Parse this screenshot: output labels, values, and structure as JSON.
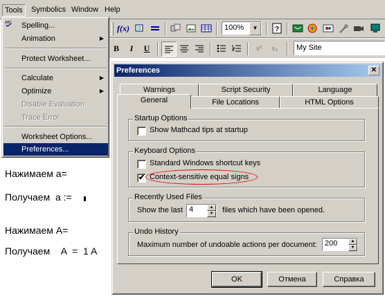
{
  "menubar": {
    "items": [
      "Tools",
      "Symbolics",
      "Window",
      "Help"
    ]
  },
  "toolbar": {
    "zoom_value": "100%",
    "style_value": "My Site",
    "fx_label": "f(x)",
    "bold": "B",
    "italic": "I",
    "underline": "U",
    "superscript": "x²",
    "subscript": "x₂"
  },
  "tools_menu": {
    "items": [
      {
        "label": "Spelling...",
        "disabled": false,
        "submenu": false
      },
      {
        "label": "Animation",
        "disabled": false,
        "submenu": true
      },
      {
        "label": "Protect Worksheet...",
        "disabled": false,
        "submenu": false
      },
      {
        "label": "Calculate",
        "disabled": false,
        "submenu": true
      },
      {
        "label": "Optimize",
        "disabled": false,
        "submenu": true
      },
      {
        "label": "Disable Evaluation",
        "disabled": true,
        "submenu": false
      },
      {
        "label": "Trace Error",
        "disabled": true,
        "submenu": false
      },
      {
        "label": "Worksheet Options...",
        "disabled": false,
        "submenu": false
      },
      {
        "label": "Preferences...",
        "disabled": false,
        "submenu": false,
        "selected": true
      }
    ]
  },
  "document": {
    "lines": [
      "Нажимаем а=",
      "Получаем  а :=",
      "Нажимаем А=",
      "Получаем    A  =  1 A"
    ]
  },
  "dialog": {
    "title": "Preferences",
    "close_glyph": "✕",
    "tabs_back": [
      "Warnings",
      "Script Security",
      "Language"
    ],
    "tabs_front": [
      "General",
      "File Locations",
      "HTML Options"
    ],
    "active_tab": "General",
    "startup": {
      "group_label": "Startup Options",
      "show_tips_label": "Show Mathcad tips at startup",
      "show_tips_checked": false
    },
    "keyboard": {
      "group_label": "Keyboard Options",
      "standard_shortcuts_label": "Standard Windows shortcut keys",
      "standard_shortcuts_checked": false,
      "context_equal_label": "Context-sensitive equal signs",
      "context_equal_checked": true
    },
    "recent_files": {
      "group_label": "Recently Used Files",
      "show_last_label": "Show the last",
      "count_value": "4",
      "suffix_label": "files which have been opened."
    },
    "undo": {
      "group_label": "Undo History",
      "max_label": "Maximum number of undoable actions per document:",
      "max_value": "200"
    },
    "buttons": {
      "ok": "OK",
      "cancel": "Отмена",
      "help": "Справка"
    }
  },
  "colors": {
    "face": "#d4d0c8",
    "highlight": "#0a246a",
    "annotation": "#e00000"
  }
}
